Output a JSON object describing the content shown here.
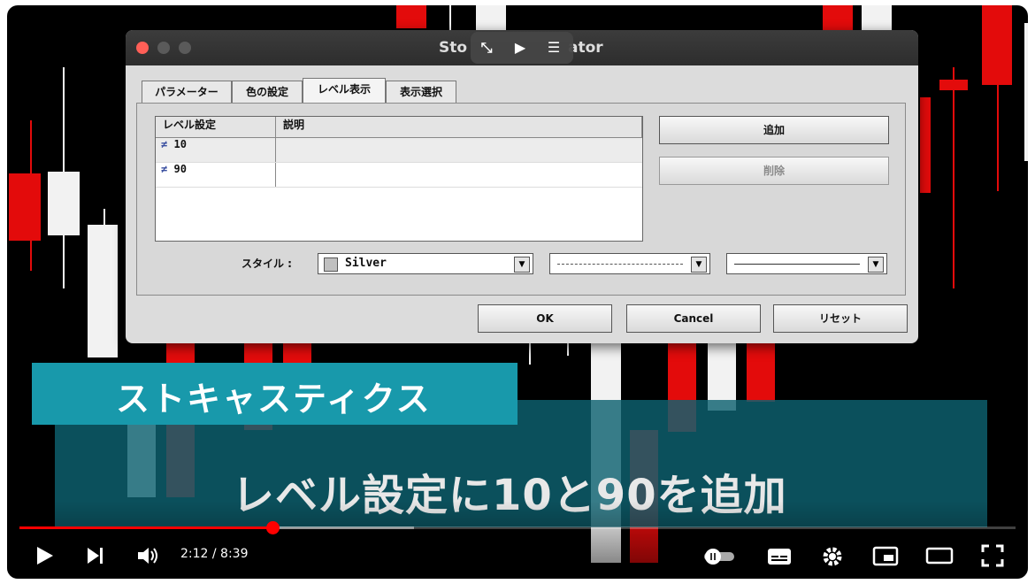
{
  "dialog": {
    "title_left": "Sto",
    "title_right": "ator",
    "tabs": [
      {
        "label": "パラメーター"
      },
      {
        "label": "色の設定"
      },
      {
        "label": "レベル表示"
      },
      {
        "label": "表示選択"
      }
    ],
    "table": {
      "headers": [
        "レベル設定",
        "説明"
      ],
      "rows": [
        {
          "level": "10",
          "desc": ""
        },
        {
          "level": "90",
          "desc": ""
        }
      ]
    },
    "add_button": "追加",
    "delete_button": "削除",
    "style_label": "スタイル :",
    "color_select": "Silver",
    "color_swatch": "#c0c0c0",
    "ok_button": "OK",
    "cancel_button": "Cancel",
    "reset_button": "リセット"
  },
  "captions": {
    "title": "ストキャスティクス",
    "subtitle": "レベル設定に10と90を追加"
  },
  "player": {
    "time": "2:12 / 8:39",
    "progress": 0.254,
    "accent": "#ff0000"
  }
}
